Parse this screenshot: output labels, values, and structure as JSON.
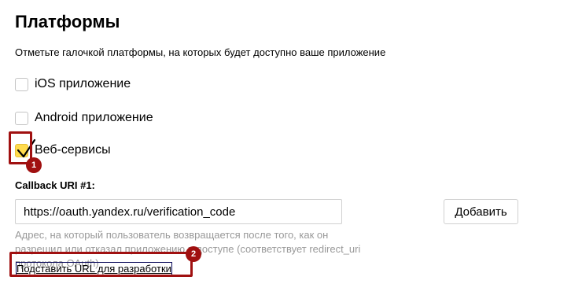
{
  "section": {
    "title": "Платформы",
    "description": "Отметьте галочкой платформы, на которых будет доступно ваше приложение"
  },
  "platforms": [
    {
      "label": "iOS приложение",
      "checked": false
    },
    {
      "label": "Android приложение",
      "checked": false
    },
    {
      "label": "Веб-сервисы",
      "checked": true
    }
  ],
  "callback": {
    "label": "Callback URI #1:",
    "value": "https://oauth.yandex.ru/verification_code",
    "add_button": "Добавить",
    "help_text": "Адрес, на который пользователь возвращается после того, как он разрешил или отказал приложению в доступе (соответствует redirect_uri протокола OAuth)",
    "dev_link": "Подставить URL для разработки"
  },
  "annotations": {
    "badge_1": "1",
    "badge_2": "2",
    "color": "#a01010"
  },
  "colors": {
    "checked_fill": "#ffdb4d",
    "help_text": "#999999"
  },
  "icons": {
    "checkmark": "checkmark-icon"
  }
}
